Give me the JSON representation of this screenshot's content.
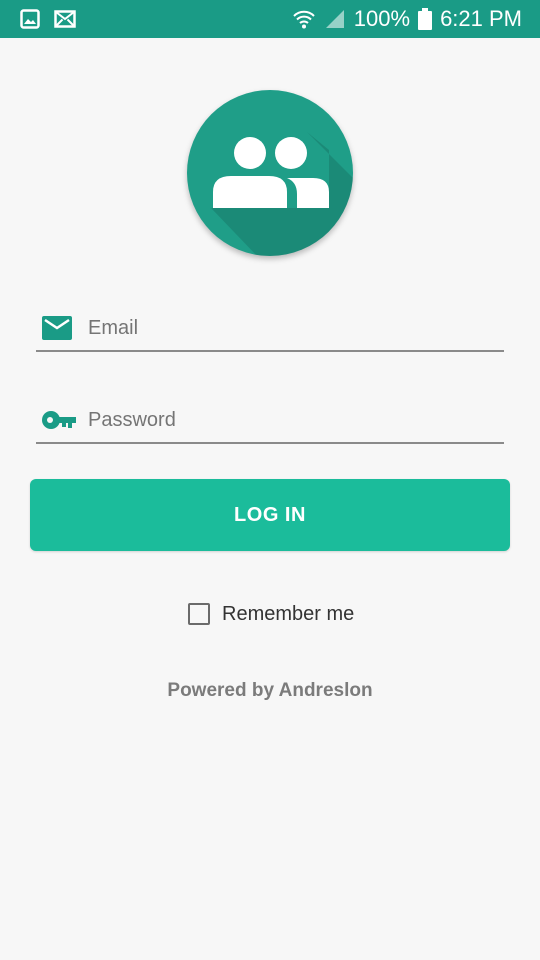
{
  "status_bar": {
    "battery": "100%",
    "time": "6:21 PM",
    "icons": [
      "image-notification-icon",
      "mail-notification-icon",
      "wifi-icon",
      "signal-icon",
      "battery-icon"
    ]
  },
  "app": {
    "logo_icon": "group-icon"
  },
  "form": {
    "email_placeholder": "Email",
    "email_value": "",
    "email_icon": "mail-icon",
    "password_placeholder": "Password",
    "password_value": "",
    "password_icon": "key-icon",
    "login_label": "LOG IN",
    "remember_label": "Remember me",
    "remember_checked": false
  },
  "footer": {
    "powered_by": "Powered by Andreslon"
  },
  "colors": {
    "status_bar": "#1a9b86",
    "accent": "#1bbc9b",
    "logo": "#1f9e88",
    "icon": "#1a9b86",
    "background": "#f7f7f7"
  }
}
